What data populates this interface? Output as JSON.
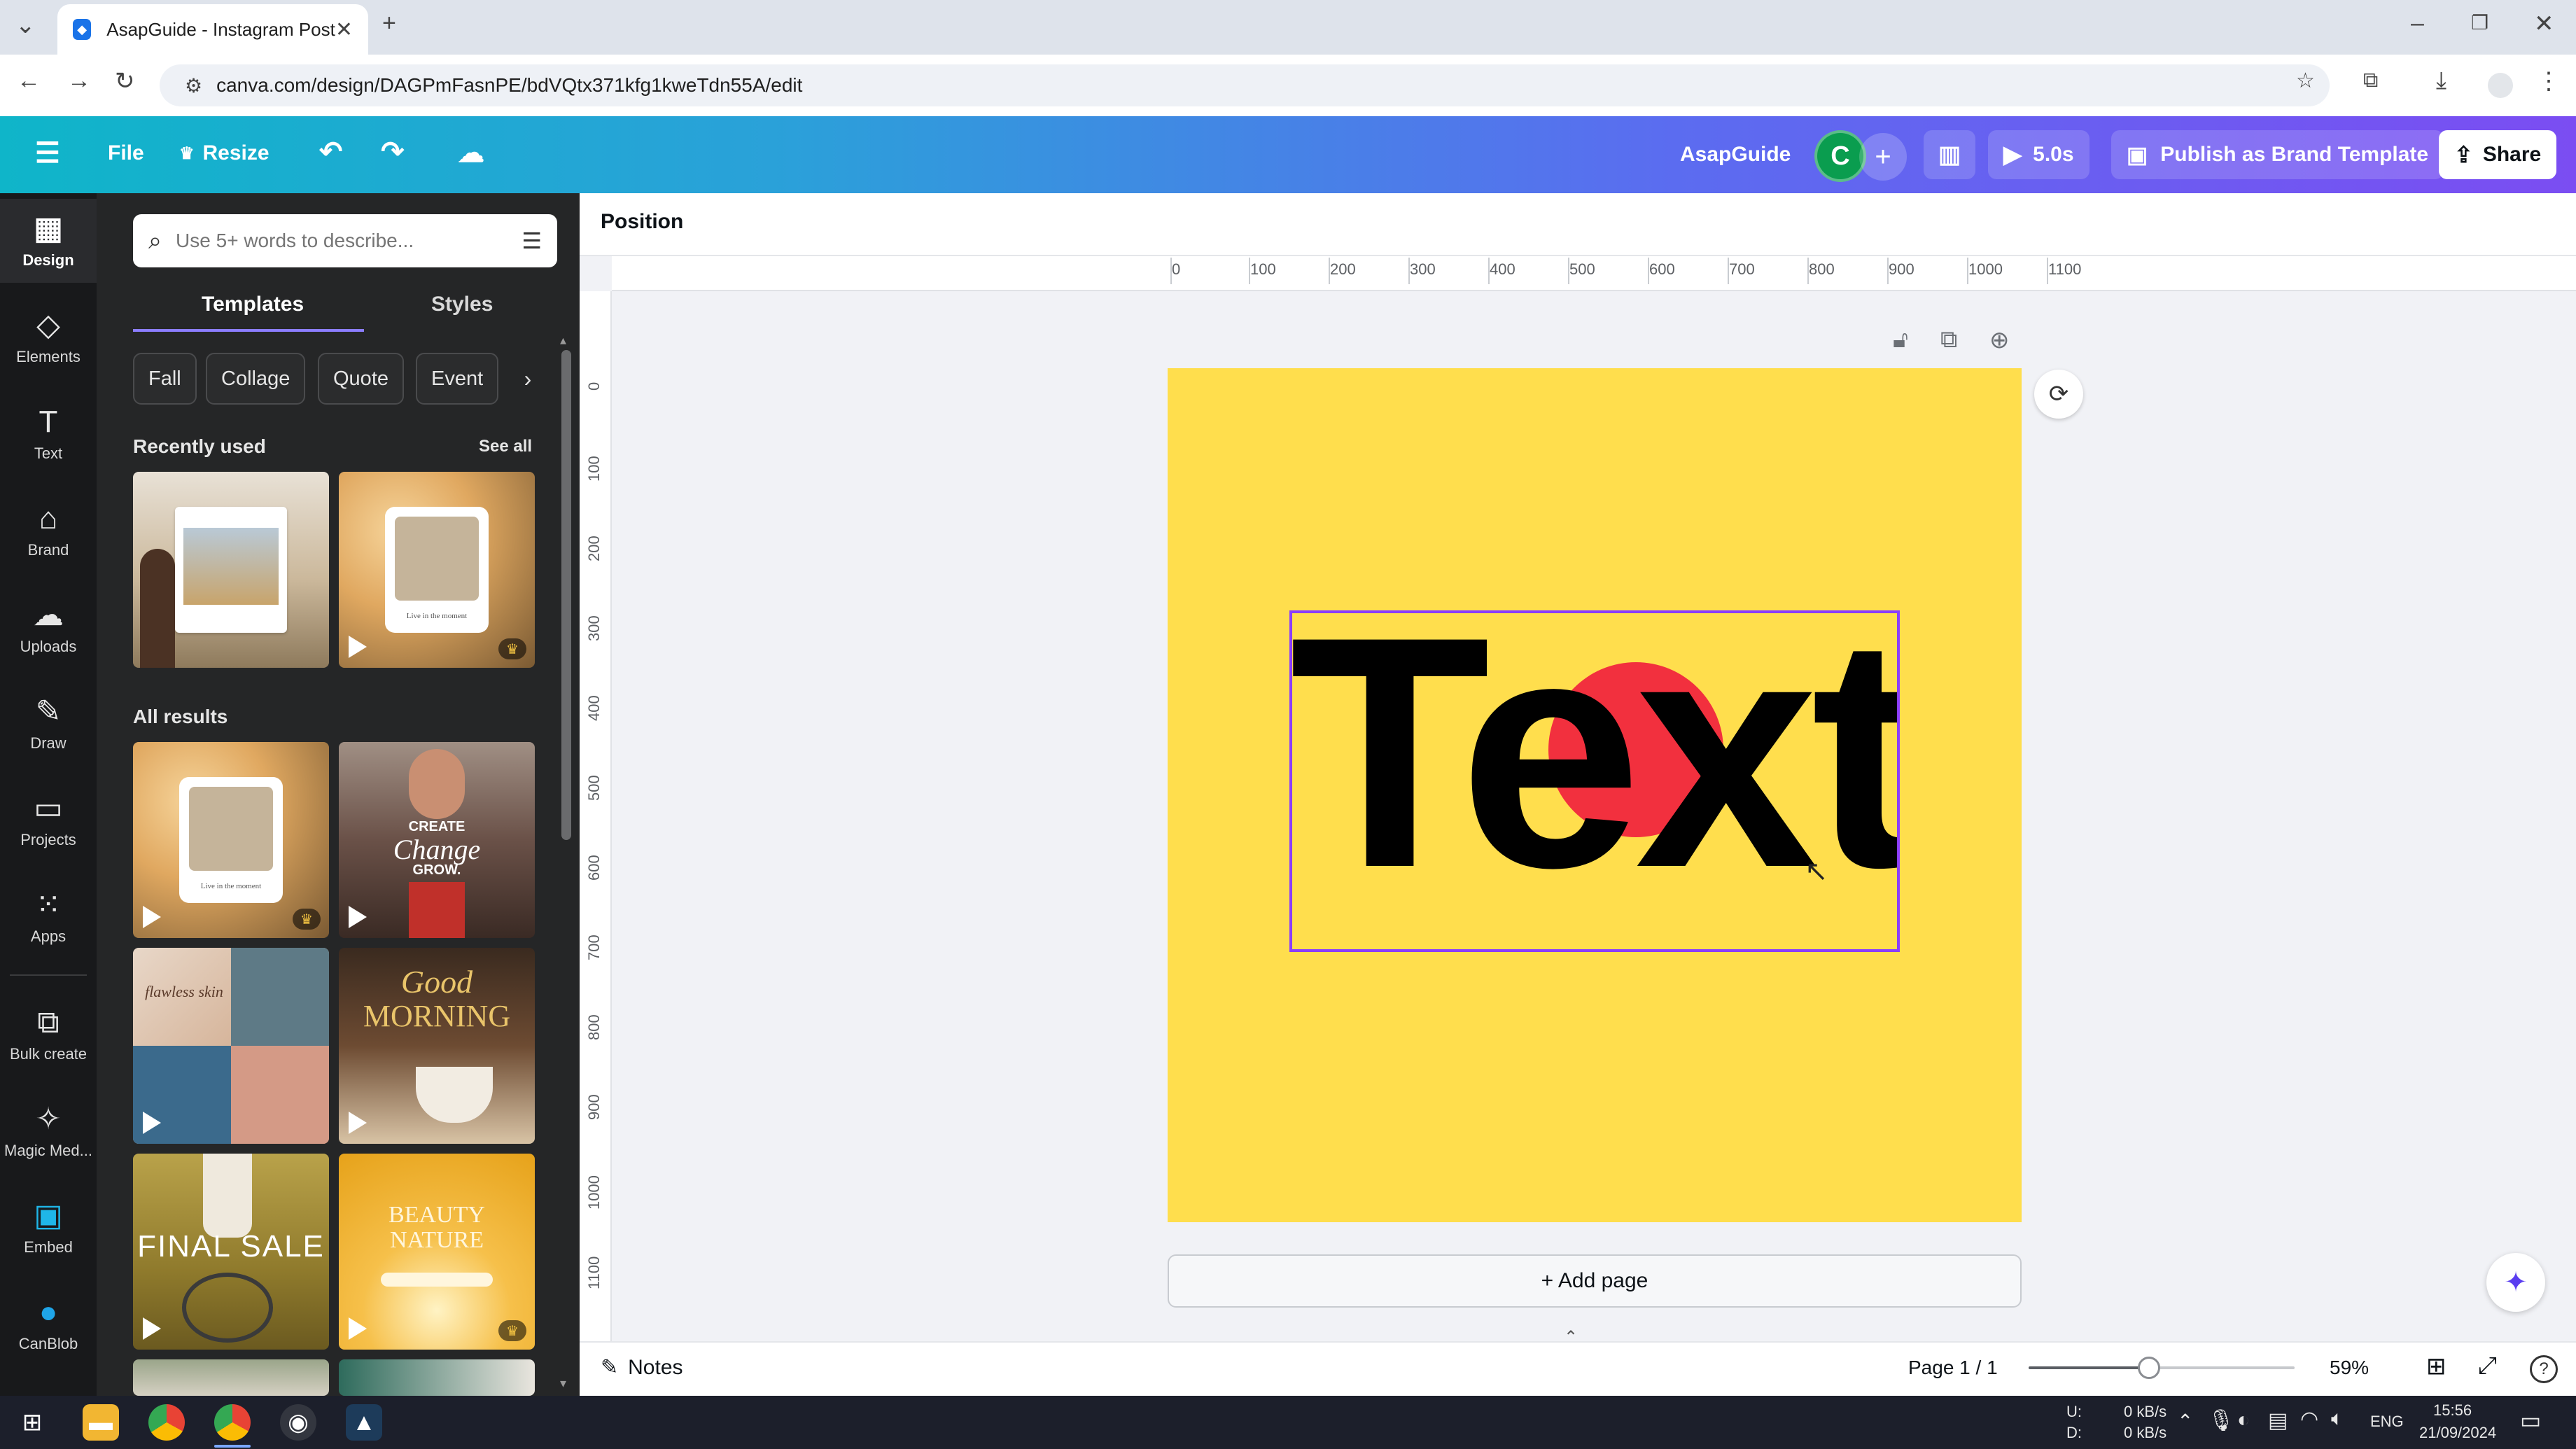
{
  "browser": {
    "tab_title": "AsapGuide - Instagram Post",
    "url": "canva.com/design/DAGPmFasnPE/bdVQtx371kfg1kweTdn55A/edit"
  },
  "topbar": {
    "file_label": "File",
    "resize_label": "Resize",
    "team_name": "AsapGuide",
    "avatar_letter": "C",
    "duration_label": "5.0s",
    "publish_label": "Publish as Brand Template",
    "share_label": "Share"
  },
  "rail": {
    "items": [
      {
        "label": "Design",
        "icon": "design-icon"
      },
      {
        "label": "Elements",
        "icon": "elements-icon"
      },
      {
        "label": "Text",
        "icon": "text-icon"
      },
      {
        "label": "Brand",
        "icon": "brand-icon"
      },
      {
        "label": "Uploads",
        "icon": "uploads-icon"
      },
      {
        "label": "Draw",
        "icon": "draw-icon"
      },
      {
        "label": "Projects",
        "icon": "projects-icon"
      },
      {
        "label": "Apps",
        "icon": "apps-icon"
      },
      {
        "label": "Bulk create",
        "icon": "bulk-create-icon"
      },
      {
        "label": "Magic Med...",
        "icon": "magic-media-icon"
      },
      {
        "label": "Embed",
        "icon": "embed-icon"
      },
      {
        "label": "CanBlob",
        "icon": "canblob-icon"
      }
    ]
  },
  "panel": {
    "search_placeholder": "Use 5+ words to describe...",
    "tabs": [
      "Templates",
      "Styles"
    ],
    "chips": [
      "Fall",
      "Collage",
      "Quote",
      "Event"
    ],
    "recently_used_title": "Recently used",
    "see_all_label": "See all",
    "all_results_title": "All results",
    "thumb_captions": {
      "live_moment": "Live in the moment",
      "create": "CREATE",
      "change": "Change",
      "grow": "GROW.",
      "flawless": "flawless skin",
      "good": "Good",
      "morning": "MORNING",
      "final_sale": "FINAL SALE",
      "beauty_nature": "BEAUTY NATURE"
    }
  },
  "editor": {
    "position_label": "Position",
    "ruler_h": [
      "0",
      "100",
      "200",
      "300",
      "400",
      "500",
      "600",
      "700",
      "800",
      "900",
      "1000",
      "1100"
    ],
    "ruler_v": [
      "0",
      "100",
      "200",
      "300",
      "400",
      "500",
      "600",
      "700",
      "800",
      "900",
      "1000",
      "1100"
    ],
    "canvas_text": "Text",
    "add_page_label": "+ Add page",
    "page_color": "#ffde4d",
    "accent_red": "#f2303e",
    "selection_color": "#8b3dff"
  },
  "bottombar": {
    "notes_label": "Notes",
    "page_indicator": "Page 1 / 1",
    "zoom_label": "59%",
    "zoom_level": 0.59
  },
  "taskbar": {
    "net_up": "0 kB/s",
    "net_down": "0 kB/s",
    "net_u": "U:",
    "net_d": "D:",
    "lang": "ENG",
    "time": "15:56",
    "date": "21/09/2024"
  }
}
